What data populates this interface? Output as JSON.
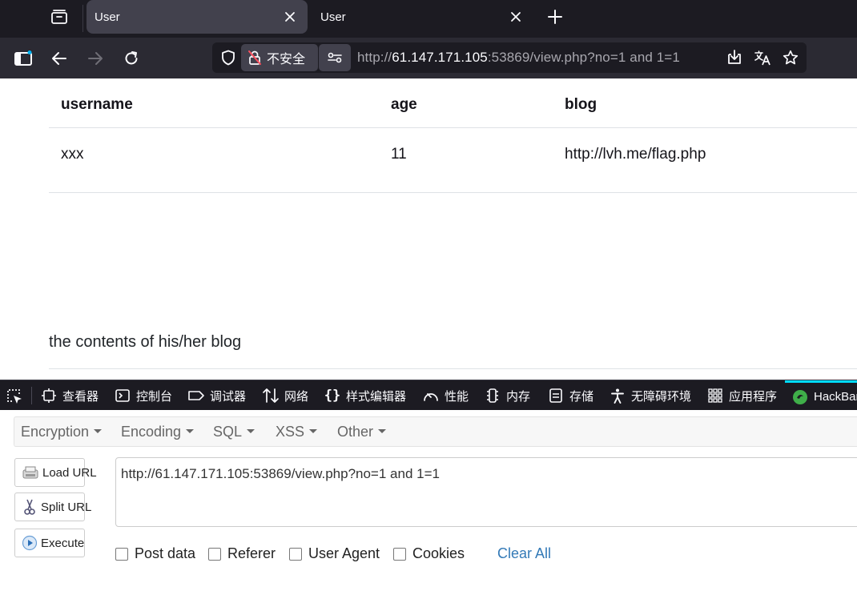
{
  "browser": {
    "tabs": [
      {
        "title": "User",
        "active": true
      },
      {
        "title": "User",
        "active": false
      }
    ],
    "security_label": "不安全",
    "url_prefix": "http://",
    "url_host": "61.147.171.105",
    "url_rest": ":53869/view.php?no=1 and 1=1"
  },
  "page": {
    "table": {
      "headers": [
        "username",
        "age",
        "blog"
      ],
      "rows": [
        [
          "xxx",
          "11",
          "http://lvh.me/flag.php"
        ]
      ]
    },
    "blog_heading": "the contents of his/her blog"
  },
  "devtools": {
    "tabs": [
      {
        "label": "查看器",
        "icon": "inspector-icon"
      },
      {
        "label": "控制台",
        "icon": "console-icon"
      },
      {
        "label": "调试器",
        "icon": "debugger-icon"
      },
      {
        "label": "网络",
        "icon": "network-icon"
      },
      {
        "label": "样式编辑器",
        "icon": "style-editor-icon"
      },
      {
        "label": "性能",
        "icon": "performance-icon"
      },
      {
        "label": "内存",
        "icon": "memory-icon"
      },
      {
        "label": "存储",
        "icon": "storage-icon"
      },
      {
        "label": "无障碍环境",
        "icon": "accessibility-icon"
      },
      {
        "label": "应用程序",
        "icon": "application-icon"
      },
      {
        "label": "HackBar",
        "icon": "hackbar-icon"
      }
    ],
    "active_color": "#00ddff"
  },
  "hackbar": {
    "menus": [
      "Encryption",
      "Encoding",
      "SQL",
      "XSS",
      "Other"
    ],
    "buttons": {
      "load": "Load URL",
      "split": "Split URL",
      "execute": "Execute"
    },
    "url_value": "http://61.147.171.105:53869/view.php?no=1 and 1=1",
    "options": [
      "Post data",
      "Referer",
      "User Agent",
      "Cookies"
    ],
    "clear_label": "Clear All",
    "link_color": "#337ab7"
  }
}
